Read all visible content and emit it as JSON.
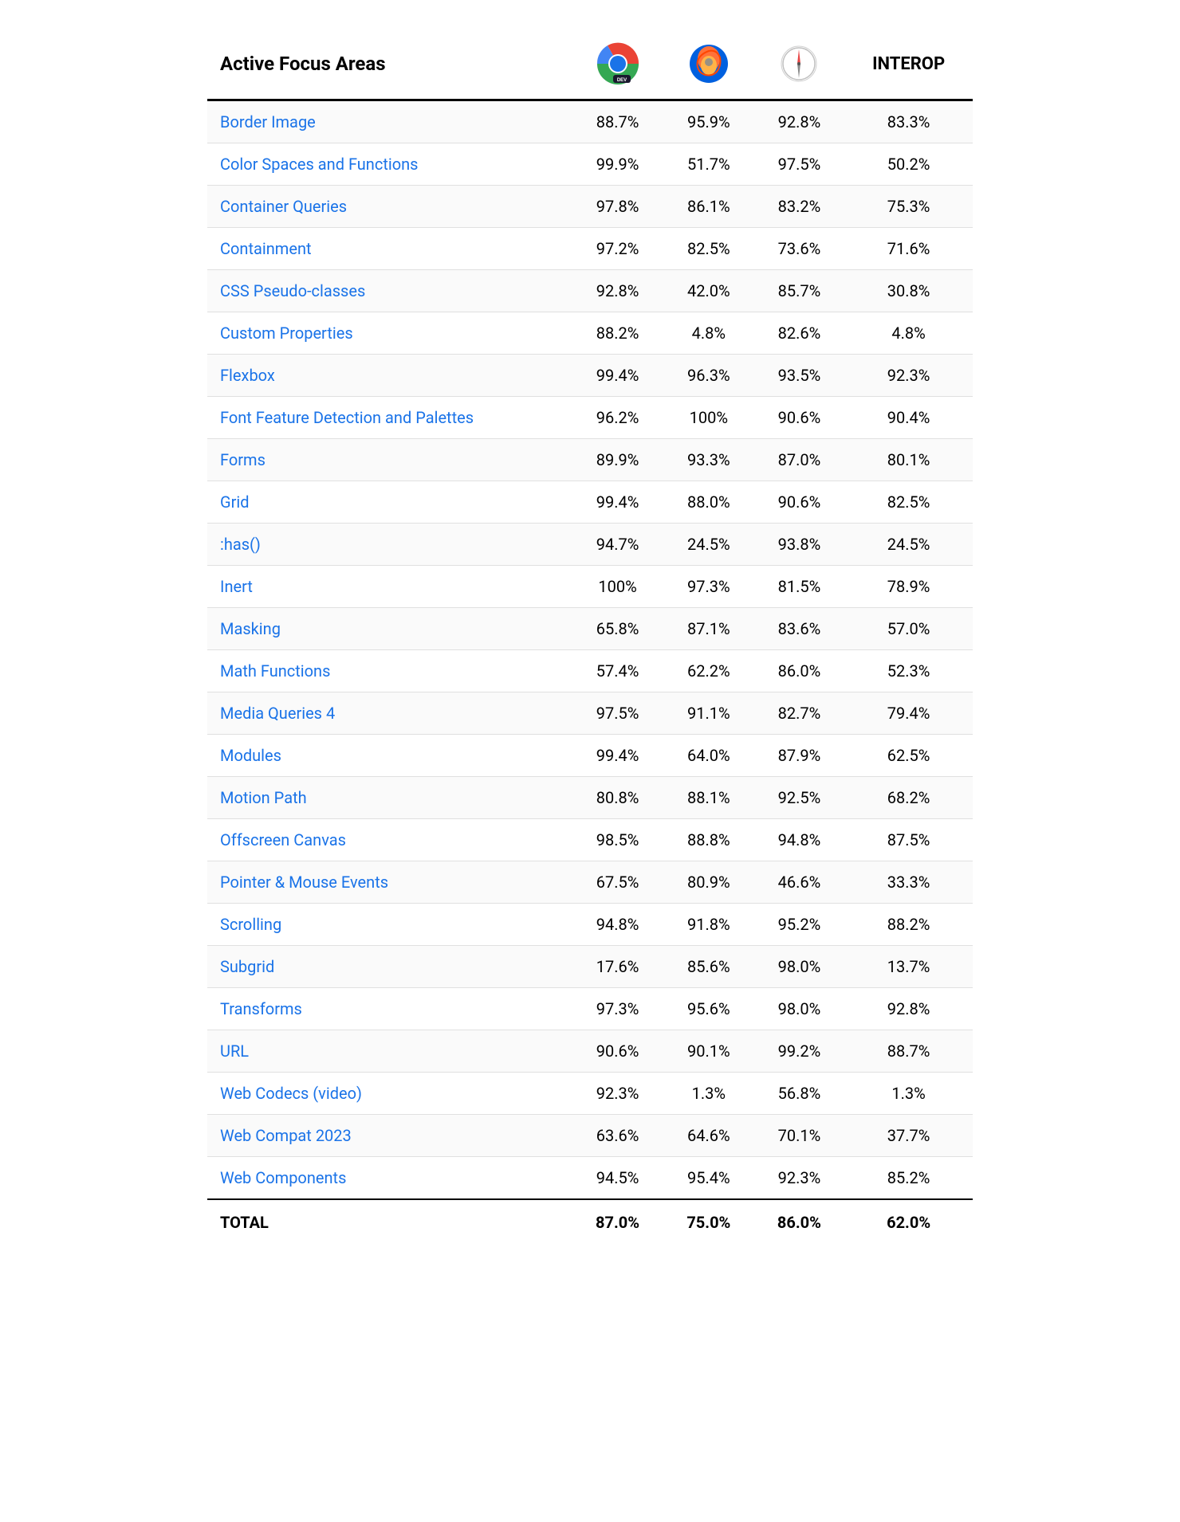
{
  "header": {
    "col1": "Active Focus Areas",
    "col4": "INTEROP"
  },
  "rows": [
    {
      "name": "Border Image",
      "col2": "88.7%",
      "col3": "95.9%",
      "col4": "92.8%",
      "col5": "83.3%"
    },
    {
      "name": "Color Spaces and Functions",
      "col2": "99.9%",
      "col3": "51.7%",
      "col4": "97.5%",
      "col5": "50.2%"
    },
    {
      "name": "Container Queries",
      "col2": "97.8%",
      "col3": "86.1%",
      "col4": "83.2%",
      "col5": "75.3%"
    },
    {
      "name": "Containment",
      "col2": "97.2%",
      "col3": "82.5%",
      "col4": "73.6%",
      "col5": "71.6%"
    },
    {
      "name": "CSS Pseudo-classes",
      "col2": "92.8%",
      "col3": "42.0%",
      "col4": "85.7%",
      "col5": "30.8%"
    },
    {
      "name": "Custom Properties",
      "col2": "88.2%",
      "col3": "4.8%",
      "col4": "82.6%",
      "col5": "4.8%"
    },
    {
      "name": "Flexbox",
      "col2": "99.4%",
      "col3": "96.3%",
      "col4": "93.5%",
      "col5": "92.3%"
    },
    {
      "name": "Font Feature Detection and Palettes",
      "col2": "96.2%",
      "col3": "100%",
      "col4": "90.6%",
      "col5": "90.4%"
    },
    {
      "name": "Forms",
      "col2": "89.9%",
      "col3": "93.3%",
      "col4": "87.0%",
      "col5": "80.1%"
    },
    {
      "name": "Grid",
      "col2": "99.4%",
      "col3": "88.0%",
      "col4": "90.6%",
      "col5": "82.5%"
    },
    {
      "name": ":has()",
      "col2": "94.7%",
      "col3": "24.5%",
      "col4": "93.8%",
      "col5": "24.5%"
    },
    {
      "name": "Inert",
      "col2": "100%",
      "col3": "97.3%",
      "col4": "81.5%",
      "col5": "78.9%"
    },
    {
      "name": "Masking",
      "col2": "65.8%",
      "col3": "87.1%",
      "col4": "83.6%",
      "col5": "57.0%"
    },
    {
      "name": "Math Functions",
      "col2": "57.4%",
      "col3": "62.2%",
      "col4": "86.0%",
      "col5": "52.3%"
    },
    {
      "name": "Media Queries 4",
      "col2": "97.5%",
      "col3": "91.1%",
      "col4": "82.7%",
      "col5": "79.4%"
    },
    {
      "name": "Modules",
      "col2": "99.4%",
      "col3": "64.0%",
      "col4": "87.9%",
      "col5": "62.5%"
    },
    {
      "name": "Motion Path",
      "col2": "80.8%",
      "col3": "88.1%",
      "col4": "92.5%",
      "col5": "68.2%"
    },
    {
      "name": "Offscreen Canvas",
      "col2": "98.5%",
      "col3": "88.8%",
      "col4": "94.8%",
      "col5": "87.5%"
    },
    {
      "name": "Pointer & Mouse Events",
      "col2": "67.5%",
      "col3": "80.9%",
      "col4": "46.6%",
      "col5": "33.3%"
    },
    {
      "name": "Scrolling",
      "col2": "94.8%",
      "col3": "91.8%",
      "col4": "95.2%",
      "col5": "88.2%"
    },
    {
      "name": "Subgrid",
      "col2": "17.6%",
      "col3": "85.6%",
      "col4": "98.0%",
      "col5": "13.7%"
    },
    {
      "name": "Transforms",
      "col2": "97.3%",
      "col3": "95.6%",
      "col4": "98.0%",
      "col5": "92.8%"
    },
    {
      "name": "URL",
      "col2": "90.6%",
      "col3": "90.1%",
      "col4": "99.2%",
      "col5": "88.7%"
    },
    {
      "name": "Web Codecs (video)",
      "col2": "92.3%",
      "col3": "1.3%",
      "col4": "56.8%",
      "col5": "1.3%"
    },
    {
      "name": "Web Compat 2023",
      "col2": "63.6%",
      "col3": "64.6%",
      "col4": "70.1%",
      "col5": "37.7%"
    },
    {
      "name": "Web Components",
      "col2": "94.5%",
      "col3": "95.4%",
      "col4": "92.3%",
      "col5": "85.2%"
    }
  ],
  "footer": {
    "label": "TOTAL",
    "col2": "87.0%",
    "col3": "75.0%",
    "col4": "86.0%",
    "col5": "62.0%"
  }
}
